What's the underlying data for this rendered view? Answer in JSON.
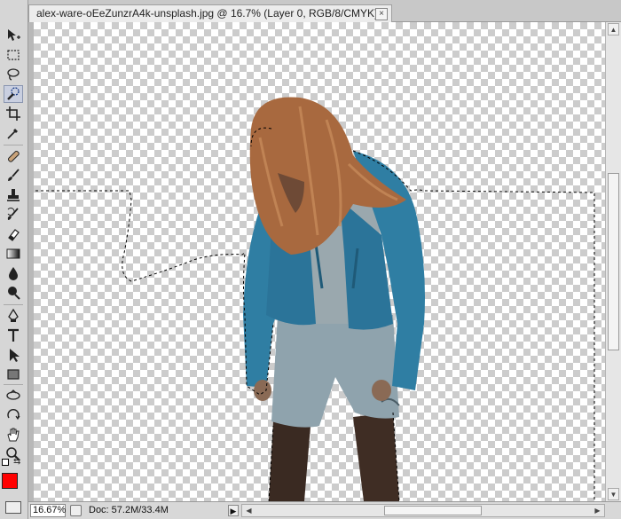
{
  "document": {
    "tab_title": "alex-ware-oEeZunzrA4k-unsplash.jpg @ 16.7% (Layer 0, RGB/8/CMYK) *",
    "close_symbol": "×"
  },
  "status": {
    "zoom": "16.67%",
    "doc_info": "Doc: 57.2M/33.4M",
    "arrow_symbol": "▶"
  },
  "scroll": {
    "up": "▲",
    "down": "▼",
    "left": "◀",
    "right": "▶"
  },
  "tools": [
    {
      "name": "move-tool-icon"
    },
    {
      "name": "rectangular-marquee-tool-icon"
    },
    {
      "name": "lasso-tool-icon"
    },
    {
      "name": "quick-selection-tool-icon",
      "active": true
    },
    {
      "name": "crop-tool-icon"
    },
    {
      "name": "eyedropper-tool-icon"
    },
    {
      "name": "spot-healing-brush-icon"
    },
    {
      "name": "brush-tool-icon"
    },
    {
      "name": "clone-stamp-tool-icon"
    },
    {
      "name": "history-brush-icon"
    },
    {
      "name": "eraser-tool-icon"
    },
    {
      "name": "gradient-tool-icon"
    },
    {
      "name": "blur-tool-icon"
    },
    {
      "name": "dodge-tool-icon"
    },
    {
      "name": "pen-tool-icon"
    },
    {
      "name": "type-tool-icon"
    },
    {
      "name": "path-selection-tool-icon"
    },
    {
      "name": "rectangle-shape-tool-icon"
    },
    {
      "name": "3d-rotate-tool-icon"
    },
    {
      "name": "3d-orbit-tool-icon"
    },
    {
      "name": "hand-tool-icon"
    },
    {
      "name": "zoom-tool-icon"
    }
  ],
  "colors": {
    "foreground": "#ff0000",
    "background": "#e8e8e8",
    "selection_border": "#000000"
  },
  "photo": {
    "subject": "person-with-long-hair-in-denim-jacket",
    "jacket_color": "#2f7ea3",
    "shorts_color": "#8fa3ad",
    "hair_color": "#a8693f"
  }
}
